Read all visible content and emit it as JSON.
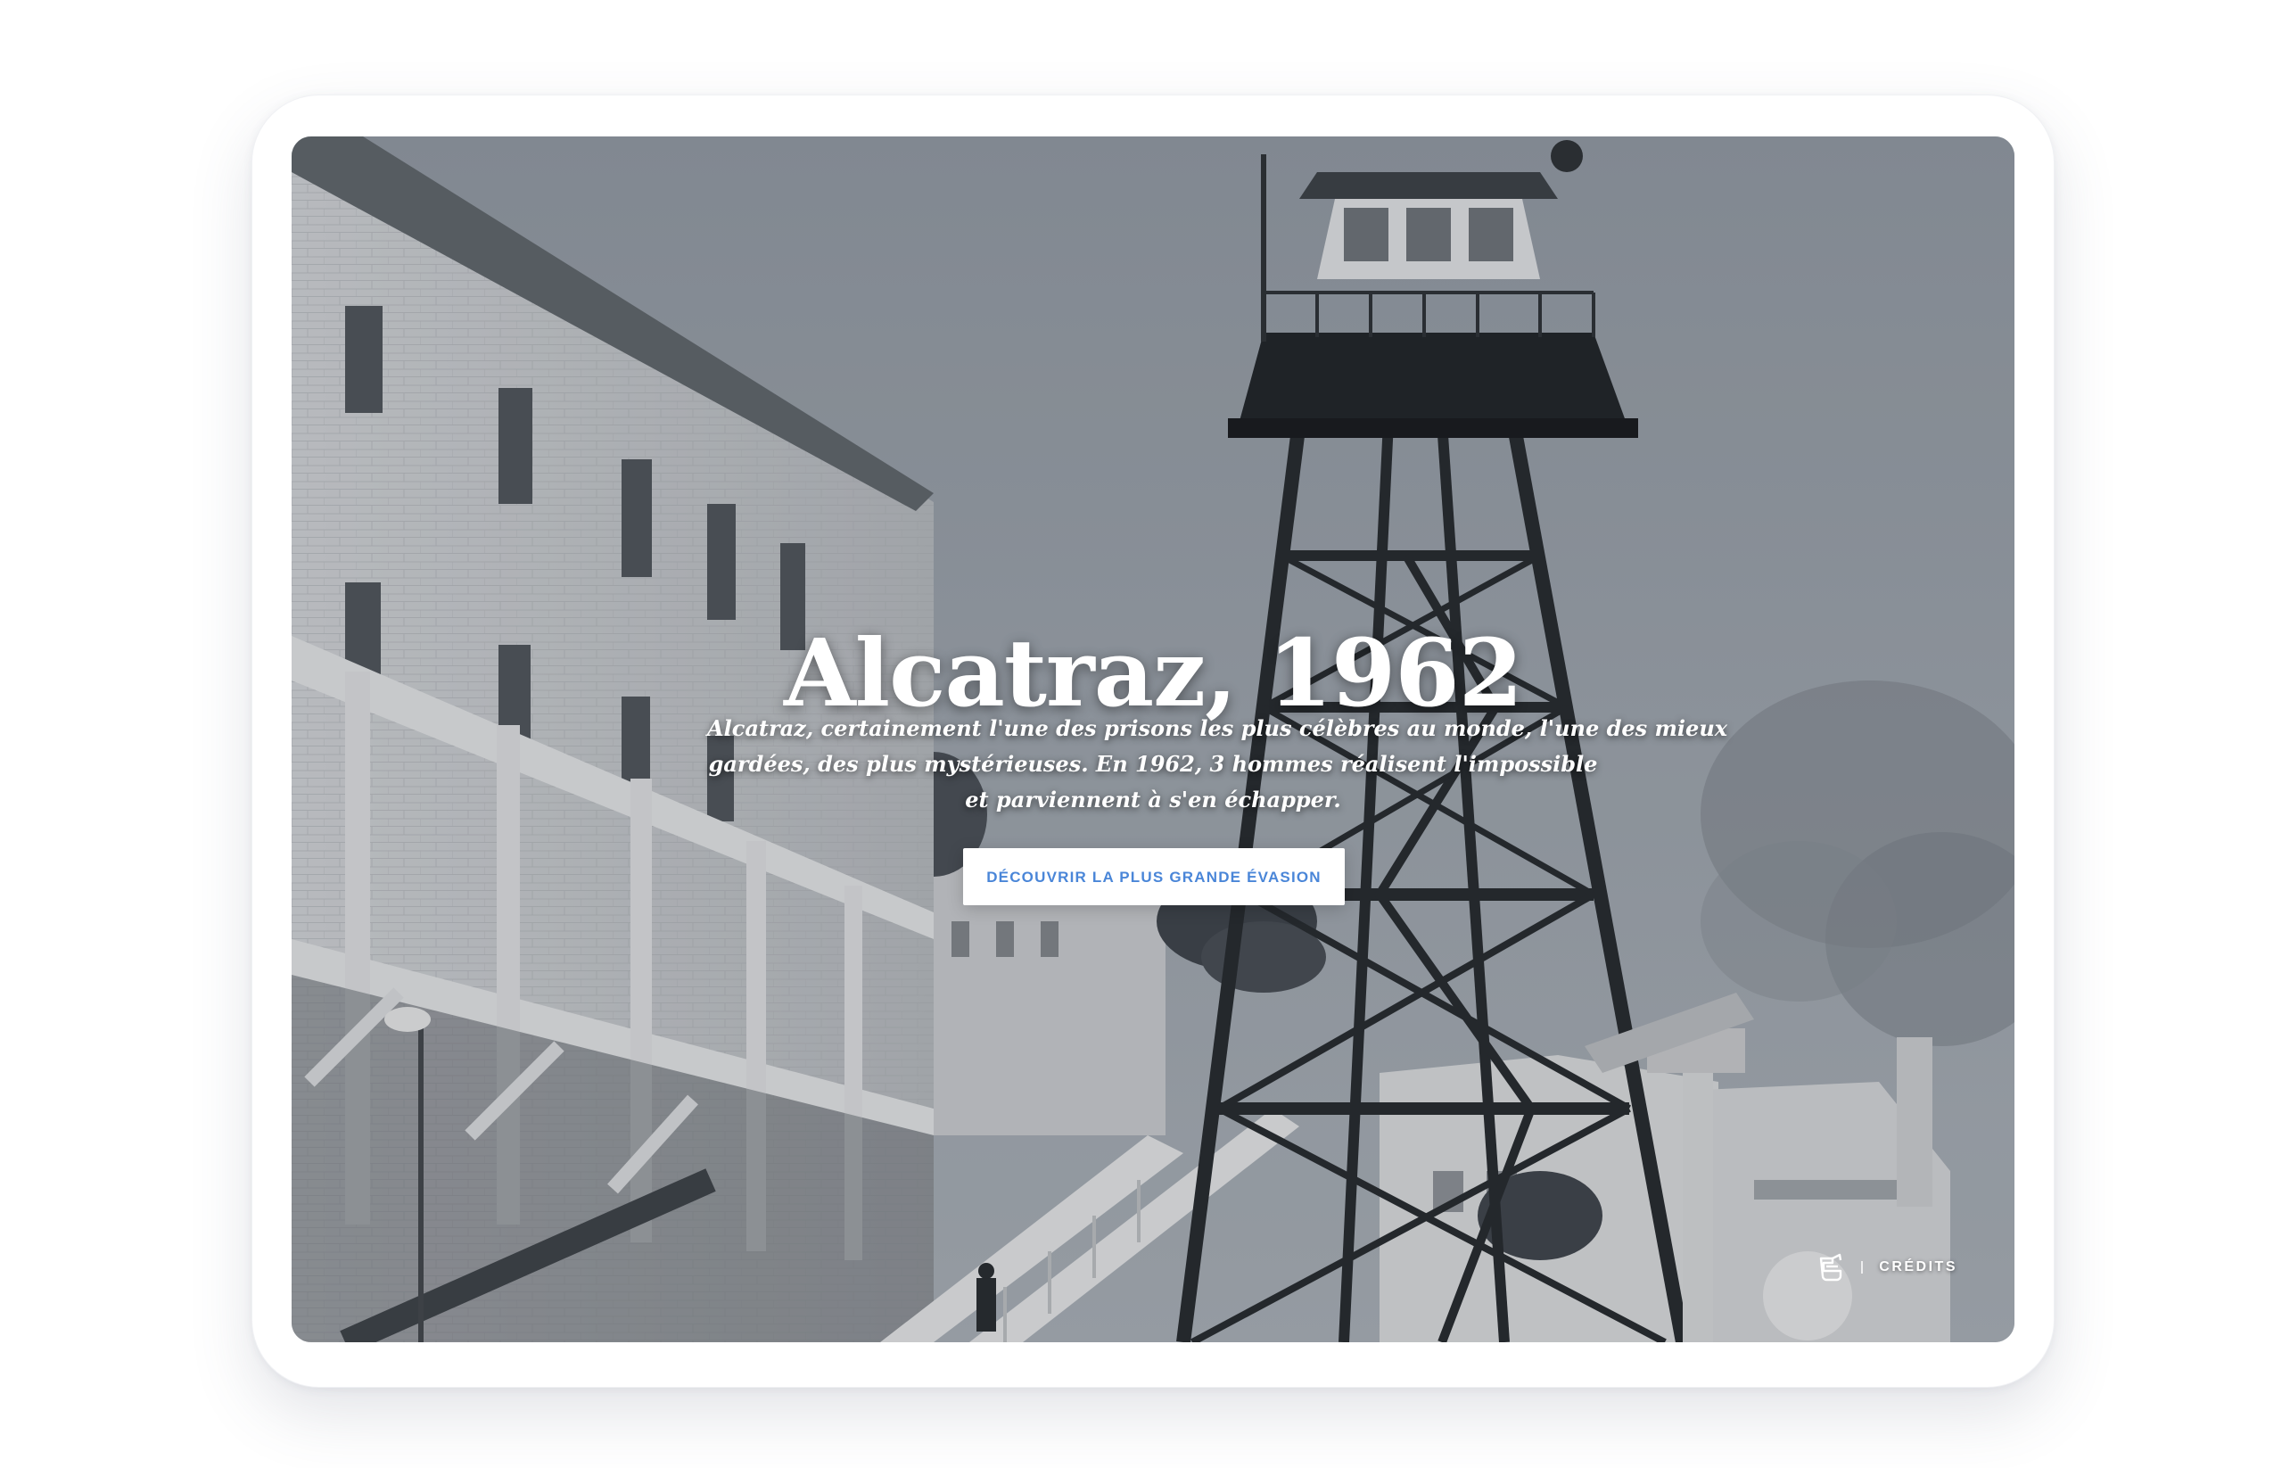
{
  "hero": {
    "title": "Alcatraz, 1962",
    "description_lines": [
      "Alcatraz, certainement l'une des prisons les plus célèbres au monde, l'une des mieux",
      "gardées, des plus mystérieuses. En 1962, 3 hommes réalisent l'impossible",
      "et parviennent à s'en échapper."
    ],
    "cta_label": "DÉCOUVRIR LA PLUS GRANDE ÉVASION"
  },
  "footer": {
    "logo_icon": "bathtub-logo-icon",
    "credits_label": "CRÉDITS"
  },
  "colors": {
    "accent": "#4a86d8",
    "overlay": "#8a9099"
  }
}
